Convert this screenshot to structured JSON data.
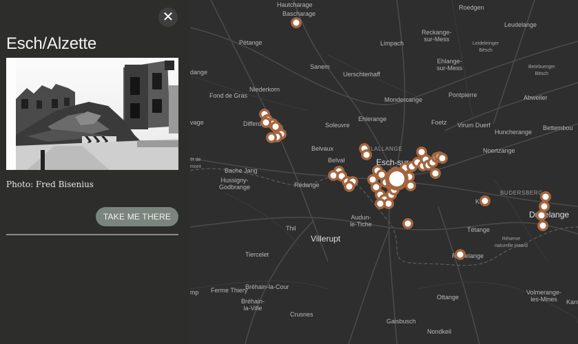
{
  "panel": {
    "close_glyph": "✕",
    "title": "Esch/Alzette",
    "caption": "Photo: Fred Bisenius",
    "cta_label": "TAKE ME THERE"
  },
  "map": {
    "labels": {
      "hautcharage": "Hautcharage",
      "bascharage": "Bascharage",
      "roedgen": "Roedgen",
      "leudelange": "Leudelange",
      "reckange": "Reckange-\nsur-Mess",
      "leideleinger": "Leideleinger\nBësch",
      "petange": "Pétange",
      "limpach": "Limpach",
      "ehlange": "Ehlange-\nsur-Mess",
      "betebuerger": "Betebuerger\nBësch",
      "sanem": "Sanem",
      "uerschterhaff": "Uerschterhaff",
      "dange": "dange",
      "niederkorn": "Niederkorn",
      "fond_de_gras": "Fond de Gras",
      "mondercange": "Mondercange",
      "pontpierre": "Pontpierre",
      "abweiler": "Abweiler",
      "differdange": "Differdange",
      "ehlerange": "Ehlerange",
      "foetz": "Foetz",
      "virum_duerf": "Virum Duerf",
      "bettembourg": "Bettembou",
      "vage": "vage",
      "soleuvre": "Soleuvre",
      "huncherange": "Huncherange",
      "belvaux": "Belvaux",
      "lallange": "LALLANGE",
      "noertzange": "Noertzange",
      "belval": "Belval",
      "esch": "Esch-sur-Alzette",
      "et_de": "ét de\nmont",
      "bache_jang": "Bache Jang",
      "hussigny": "Hussigny-\nGodbrange",
      "redange": "Rédange",
      "budersberg": "BUDERSBERG",
      "kayl": "Kayl",
      "dudelange": "Dudelange",
      "audun": "Audun-\nle-Tiche",
      "tetange": "Tétange",
      "reserve": "Réserve\nnaturelle Haard",
      "thil": "Thil",
      "villerupt": "Villerupt",
      "tiercelet": "Tiercelet",
      "rumelange": "Rumelange",
      "brehain_cour": "Bréhain-la-Cour",
      "ferme_thiery": "Ferme Thiery",
      "mp": "mp",
      "brehain_ville": "Bréhain-\nla-Ville",
      "volmerange": "Volmerange-\nles-Mines",
      "ottange": "Ottange",
      "kanf": "Kanf",
      "crusnes": "Crusnes",
      "gaisbusch": "Gaisbusch",
      "nondkeil": "Nondkeil"
    }
  }
}
